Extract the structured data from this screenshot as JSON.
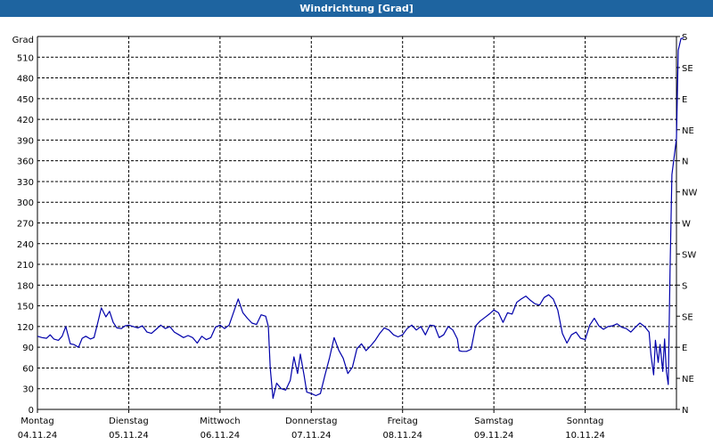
{
  "window": {
    "title": "Windrichtung [Grad]"
  },
  "chart_data": {
    "type": "line",
    "title": "Windrichtung [Grad]",
    "ylabel": "Grad",
    "ylim": [
      0,
      540
    ],
    "grid": true,
    "y_ticks": [
      0,
      30,
      60,
      90,
      120,
      150,
      180,
      210,
      240,
      270,
      300,
      330,
      360,
      390,
      420,
      450,
      480,
      510
    ],
    "right_ticks": [
      {
        "value": 0,
        "label": "N"
      },
      {
        "value": 45,
        "label": "NE"
      },
      {
        "value": 90,
        "label": "E"
      },
      {
        "value": 135,
        "label": "SE"
      },
      {
        "value": 180,
        "label": "S"
      },
      {
        "value": 225,
        "label": "SW"
      },
      {
        "value": 270,
        "label": "W"
      },
      {
        "value": 315,
        "label": "NW"
      },
      {
        "value": 360,
        "label": "N"
      },
      {
        "value": 405,
        "label": "NE"
      },
      {
        "value": 450,
        "label": "E"
      },
      {
        "value": 495,
        "label": "SE"
      },
      {
        "value": 540,
        "label": "S"
      }
    ],
    "x_ticks": [
      {
        "day": 0,
        "weekday": "Montag",
        "date": "04.11.24"
      },
      {
        "day": 1,
        "weekday": "Dienstag",
        "date": "05.11.24"
      },
      {
        "day": 2,
        "weekday": "Mittwoch",
        "date": "06.11.24"
      },
      {
        "day": 3,
        "weekday": "Donnerstag",
        "date": "07.11.24"
      },
      {
        "day": 4,
        "weekday": "Freitag",
        "date": "08.11.24"
      },
      {
        "day": 5,
        "weekday": "Samstag",
        "date": "09.11.24"
      },
      {
        "day": 6,
        "weekday": "Sonntag",
        "date": "10.11.24"
      }
    ],
    "xlim_days": [
      0,
      7
    ],
    "series": [
      {
        "color": "#0000aa",
        "points": [
          [
            0.0,
            106
          ],
          [
            0.05,
            104
          ],
          [
            0.1,
            103
          ],
          [
            0.14,
            108
          ],
          [
            0.18,
            102
          ],
          [
            0.23,
            100
          ],
          [
            0.27,
            106
          ],
          [
            0.31,
            120
          ],
          [
            0.36,
            95
          ],
          [
            0.4,
            94
          ],
          [
            0.45,
            90
          ],
          [
            0.49,
            103
          ],
          [
            0.53,
            106
          ],
          [
            0.58,
            102
          ],
          [
            0.62,
            104
          ],
          [
            0.66,
            125
          ],
          [
            0.7,
            147
          ],
          [
            0.75,
            134
          ],
          [
            0.79,
            142
          ],
          [
            0.83,
            126
          ],
          [
            0.87,
            118
          ],
          [
            0.92,
            117
          ],
          [
            0.96,
            121
          ],
          [
            1.0,
            122
          ],
          [
            1.05,
            120
          ],
          [
            1.1,
            118
          ],
          [
            1.15,
            121
          ],
          [
            1.2,
            112
          ],
          [
            1.25,
            110
          ],
          [
            1.3,
            116
          ],
          [
            1.35,
            122
          ],
          [
            1.4,
            117
          ],
          [
            1.45,
            120
          ],
          [
            1.5,
            112
          ],
          [
            1.55,
            108
          ],
          [
            1.6,
            104
          ],
          [
            1.65,
            107
          ],
          [
            1.7,
            104
          ],
          [
            1.75,
            96
          ],
          [
            1.8,
            106
          ],
          [
            1.85,
            101
          ],
          [
            1.9,
            104
          ],
          [
            1.95,
            119
          ],
          [
            2.0,
            122
          ],
          [
            2.05,
            117
          ],
          [
            2.1,
            122
          ],
          [
            2.15,
            141
          ],
          [
            2.2,
            160
          ],
          [
            2.25,
            140
          ],
          [
            2.3,
            132
          ],
          [
            2.35,
            125
          ],
          [
            2.4,
            123
          ],
          [
            2.45,
            137
          ],
          [
            2.5,
            135
          ],
          [
            2.53,
            120
          ],
          [
            2.55,
            60
          ],
          [
            2.58,
            16
          ],
          [
            2.62,
            38
          ],
          [
            2.67,
            30
          ],
          [
            2.72,
            28
          ],
          [
            2.77,
            42
          ],
          [
            2.81,
            76
          ],
          [
            2.85,
            52
          ],
          [
            2.88,
            80
          ],
          [
            2.92,
            50
          ],
          [
            2.95,
            25
          ],
          [
            3.0,
            23
          ],
          [
            3.05,
            20
          ],
          [
            3.1,
            23
          ],
          [
            3.15,
            50
          ],
          [
            3.2,
            75
          ],
          [
            3.25,
            104
          ],
          [
            3.3,
            86
          ],
          [
            3.35,
            74
          ],
          [
            3.4,
            52
          ],
          [
            3.45,
            61
          ],
          [
            3.5,
            88
          ],
          [
            3.55,
            95
          ],
          [
            3.6,
            85
          ],
          [
            3.65,
            92
          ],
          [
            3.7,
            100
          ],
          [
            3.75,
            110
          ],
          [
            3.8,
            118
          ],
          [
            3.85,
            115
          ],
          [
            3.9,
            108
          ],
          [
            3.95,
            105
          ],
          [
            4.0,
            108
          ],
          [
            4.05,
            117
          ],
          [
            4.1,
            122
          ],
          [
            4.15,
            115
          ],
          [
            4.2,
            120
          ],
          [
            4.25,
            108
          ],
          [
            4.3,
            122
          ],
          [
            4.35,
            121
          ],
          [
            4.4,
            104
          ],
          [
            4.45,
            108
          ],
          [
            4.5,
            120
          ],
          [
            4.55,
            115
          ],
          [
            4.6,
            102
          ],
          [
            4.62,
            85
          ],
          [
            4.65,
            84
          ],
          [
            4.7,
            84
          ],
          [
            4.75,
            87
          ],
          [
            4.8,
            121
          ],
          [
            4.85,
            128
          ],
          [
            4.9,
            133
          ],
          [
            4.95,
            138
          ],
          [
            5.0,
            144
          ],
          [
            5.05,
            140
          ],
          [
            5.1,
            126
          ],
          [
            5.15,
            140
          ],
          [
            5.2,
            138
          ],
          [
            5.25,
            155
          ],
          [
            5.3,
            160
          ],
          [
            5.35,
            164
          ],
          [
            5.4,
            158
          ],
          [
            5.45,
            153
          ],
          [
            5.5,
            151
          ],
          [
            5.55,
            162
          ],
          [
            5.6,
            166
          ],
          [
            5.65,
            160
          ],
          [
            5.7,
            144
          ],
          [
            5.75,
            110
          ],
          [
            5.8,
            96
          ],
          [
            5.85,
            108
          ],
          [
            5.9,
            112
          ],
          [
            5.95,
            103
          ],
          [
            6.0,
            101
          ],
          [
            6.05,
            122
          ],
          [
            6.1,
            132
          ],
          [
            6.15,
            121
          ],
          [
            6.2,
            116
          ],
          [
            6.25,
            120
          ],
          [
            6.3,
            121
          ],
          [
            6.35,
            124
          ],
          [
            6.4,
            119
          ],
          [
            6.45,
            117
          ],
          [
            6.5,
            112
          ],
          [
            6.55,
            119
          ],
          [
            6.6,
            125
          ],
          [
            6.65,
            120
          ],
          [
            6.7,
            112
          ],
          [
            6.72,
            80
          ],
          [
            6.75,
            50
          ],
          [
            6.77,
            100
          ],
          [
            6.8,
            68
          ],
          [
            6.82,
            94
          ],
          [
            6.85,
            55
          ],
          [
            6.87,
            102
          ],
          [
            6.89,
            55
          ],
          [
            6.91,
            36
          ],
          [
            6.93,
            200
          ],
          [
            6.95,
            340
          ],
          [
            7.0,
            392
          ],
          [
            7.02,
            520
          ],
          [
            7.05,
            537
          ],
          [
            7.08,
            538
          ]
        ]
      }
    ]
  }
}
